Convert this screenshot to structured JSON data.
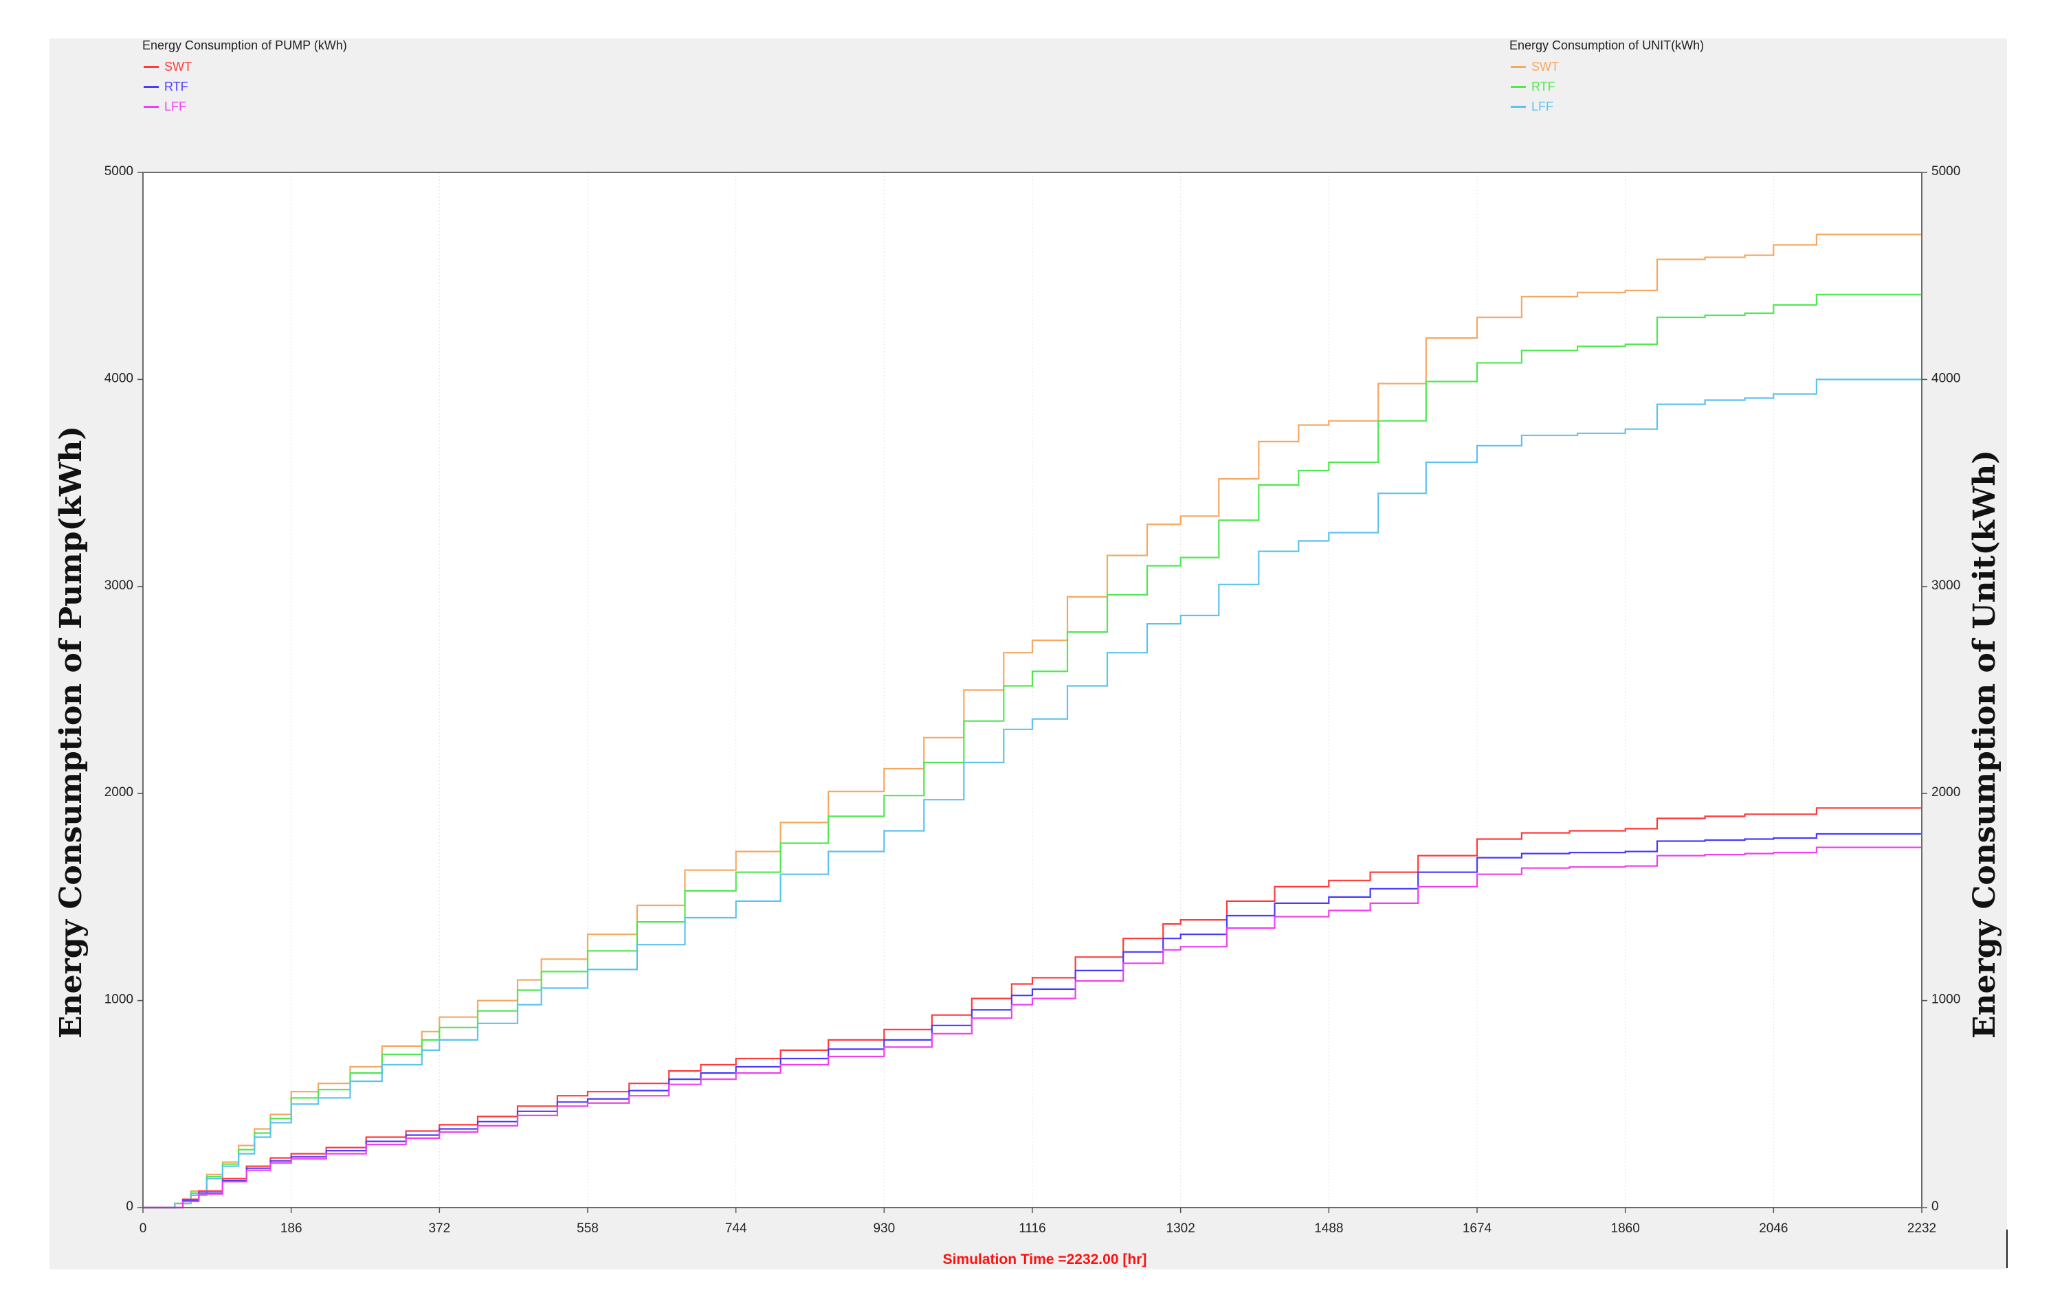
{
  "chart_data": {
    "type": "line",
    "x_axis": {
      "range": [
        0,
        2232
      ],
      "ticks": [
        0,
        186,
        372,
        558,
        744,
        930,
        1116,
        1302,
        1488,
        1674,
        1860,
        2046,
        2232
      ],
      "footer": "Simulation Time =2232.00 [hr]"
    },
    "y_left": {
      "label": "Energy Consumption of Pump(kWh)",
      "range": [
        0,
        5000
      ],
      "ticks": [
        0,
        1000,
        2000,
        3000,
        4000,
        5000
      ]
    },
    "y_right": {
      "label": "Energy Consumption of Unit(kWh)",
      "range": [
        0,
        5000
      ],
      "ticks": [
        0,
        1000,
        2000,
        3000,
        4000,
        5000
      ]
    },
    "legend_left": {
      "title": "Energy Consumption of PUMP (kWh)",
      "placement": "top-left",
      "entries": [
        "SWT",
        "RTF",
        "LFF"
      ]
    },
    "legend_right": {
      "title": "Energy Consumption of UNIT(kWh)",
      "placement": "top-right",
      "entries": [
        "SWT",
        "RTF",
        "LFF"
      ]
    },
    "grid": true,
    "series": [
      {
        "name": "SWT",
        "group": "UNIT",
        "color": "#f5a860",
        "points": [
          [
            0,
            0
          ],
          [
            20,
            0
          ],
          [
            40,
            20
          ],
          [
            60,
            80
          ],
          [
            80,
            160
          ],
          [
            100,
            220
          ],
          [
            120,
            300
          ],
          [
            140,
            380
          ],
          [
            160,
            450
          ],
          [
            186,
            560
          ],
          [
            220,
            600
          ],
          [
            260,
            680
          ],
          [
            300,
            780
          ],
          [
            350,
            850
          ],
          [
            372,
            920
          ],
          [
            420,
            1000
          ],
          [
            470,
            1100
          ],
          [
            500,
            1200
          ],
          [
            558,
            1320
          ],
          [
            620,
            1460
          ],
          [
            680,
            1630
          ],
          [
            744,
            1720
          ],
          [
            800,
            1860
          ],
          [
            860,
            2010
          ],
          [
            930,
            2120
          ],
          [
            980,
            2270
          ],
          [
            1030,
            2500
          ],
          [
            1080,
            2680
          ],
          [
            1116,
            2740
          ],
          [
            1160,
            2950
          ],
          [
            1210,
            3150
          ],
          [
            1260,
            3300
          ],
          [
            1302,
            3340
          ],
          [
            1350,
            3520
          ],
          [
            1400,
            3700
          ],
          [
            1450,
            3780
          ],
          [
            1488,
            3800
          ],
          [
            1550,
            3980
          ],
          [
            1610,
            4200
          ],
          [
            1674,
            4300
          ],
          [
            1730,
            4400
          ],
          [
            1800,
            4420
          ],
          [
            1860,
            4430
          ],
          [
            1900,
            4580
          ],
          [
            1960,
            4590
          ],
          [
            2010,
            4600
          ],
          [
            2046,
            4650
          ],
          [
            2100,
            4700
          ],
          [
            2232,
            4700
          ]
        ]
      },
      {
        "name": "RTF",
        "group": "UNIT",
        "color": "#50e850",
        "points": [
          [
            0,
            0
          ],
          [
            20,
            0
          ],
          [
            40,
            20
          ],
          [
            60,
            70
          ],
          [
            80,
            150
          ],
          [
            100,
            210
          ],
          [
            120,
            280
          ],
          [
            140,
            360
          ],
          [
            160,
            430
          ],
          [
            186,
            530
          ],
          [
            220,
            570
          ],
          [
            260,
            650
          ],
          [
            300,
            740
          ],
          [
            350,
            810
          ],
          [
            372,
            870
          ],
          [
            420,
            950
          ],
          [
            470,
            1050
          ],
          [
            500,
            1140
          ],
          [
            558,
            1240
          ],
          [
            620,
            1380
          ],
          [
            680,
            1530
          ],
          [
            744,
            1620
          ],
          [
            800,
            1760
          ],
          [
            860,
            1890
          ],
          [
            930,
            1990
          ],
          [
            980,
            2150
          ],
          [
            1030,
            2350
          ],
          [
            1080,
            2520
          ],
          [
            1116,
            2590
          ],
          [
            1160,
            2780
          ],
          [
            1210,
            2960
          ],
          [
            1260,
            3100
          ],
          [
            1302,
            3140
          ],
          [
            1350,
            3320
          ],
          [
            1400,
            3490
          ],
          [
            1450,
            3560
          ],
          [
            1488,
            3600
          ],
          [
            1550,
            3800
          ],
          [
            1610,
            3990
          ],
          [
            1674,
            4080
          ],
          [
            1730,
            4140
          ],
          [
            1800,
            4160
          ],
          [
            1860,
            4170
          ],
          [
            1900,
            4300
          ],
          [
            1960,
            4310
          ],
          [
            2010,
            4320
          ],
          [
            2046,
            4360
          ],
          [
            2100,
            4410
          ],
          [
            2232,
            4410
          ]
        ]
      },
      {
        "name": "LFF",
        "group": "UNIT",
        "color": "#5cc2ee",
        "points": [
          [
            0,
            0
          ],
          [
            20,
            0
          ],
          [
            40,
            20
          ],
          [
            60,
            60
          ],
          [
            80,
            140
          ],
          [
            100,
            200
          ],
          [
            120,
            260
          ],
          [
            140,
            340
          ],
          [
            160,
            410
          ],
          [
            186,
            500
          ],
          [
            220,
            530
          ],
          [
            260,
            610
          ],
          [
            300,
            690
          ],
          [
            350,
            760
          ],
          [
            372,
            810
          ],
          [
            420,
            890
          ],
          [
            470,
            980
          ],
          [
            500,
            1060
          ],
          [
            558,
            1150
          ],
          [
            620,
            1270
          ],
          [
            680,
            1400
          ],
          [
            744,
            1480
          ],
          [
            800,
            1610
          ],
          [
            860,
            1720
          ],
          [
            930,
            1820
          ],
          [
            980,
            1970
          ],
          [
            1030,
            2150
          ],
          [
            1080,
            2310
          ],
          [
            1116,
            2360
          ],
          [
            1160,
            2520
          ],
          [
            1210,
            2680
          ],
          [
            1260,
            2820
          ],
          [
            1302,
            2860
          ],
          [
            1350,
            3010
          ],
          [
            1400,
            3170
          ],
          [
            1450,
            3220
          ],
          [
            1488,
            3260
          ],
          [
            1550,
            3450
          ],
          [
            1610,
            3600
          ],
          [
            1674,
            3680
          ],
          [
            1730,
            3730
          ],
          [
            1800,
            3740
          ],
          [
            1860,
            3760
          ],
          [
            1900,
            3880
          ],
          [
            1960,
            3900
          ],
          [
            2010,
            3910
          ],
          [
            2046,
            3930
          ],
          [
            2100,
            4000
          ],
          [
            2232,
            4000
          ]
        ]
      },
      {
        "name": "SWT",
        "group": "PUMP",
        "color": "#ff3a3a",
        "points": [
          [
            0,
            0
          ],
          [
            30,
            0
          ],
          [
            50,
            40
          ],
          [
            70,
            80
          ],
          [
            100,
            140
          ],
          [
            130,
            200
          ],
          [
            160,
            240
          ],
          [
            186,
            260
          ],
          [
            230,
            290
          ],
          [
            280,
            340
          ],
          [
            330,
            370
          ],
          [
            372,
            400
          ],
          [
            420,
            440
          ],
          [
            470,
            490
          ],
          [
            520,
            540
          ],
          [
            558,
            560
          ],
          [
            610,
            600
          ],
          [
            660,
            660
          ],
          [
            700,
            690
          ],
          [
            744,
            720
          ],
          [
            800,
            760
          ],
          [
            860,
            810
          ],
          [
            930,
            860
          ],
          [
            990,
            930
          ],
          [
            1040,
            1010
          ],
          [
            1090,
            1080
          ],
          [
            1116,
            1110
          ],
          [
            1170,
            1210
          ],
          [
            1230,
            1300
          ],
          [
            1280,
            1370
          ],
          [
            1302,
            1390
          ],
          [
            1360,
            1480
          ],
          [
            1420,
            1550
          ],
          [
            1488,
            1580
          ],
          [
            1540,
            1620
          ],
          [
            1600,
            1700
          ],
          [
            1674,
            1780
          ],
          [
            1730,
            1810
          ],
          [
            1790,
            1820
          ],
          [
            1860,
            1830
          ],
          [
            1900,
            1880
          ],
          [
            1960,
            1890
          ],
          [
            2010,
            1900
          ],
          [
            2046,
            1900
          ],
          [
            2100,
            1930
          ],
          [
            2232,
            1930
          ]
        ]
      },
      {
        "name": "RTF",
        "group": "PUMP",
        "color": "#4a3aff",
        "points": [
          [
            0,
            0
          ],
          [
            30,
            0
          ],
          [
            50,
            35
          ],
          [
            70,
            70
          ],
          [
            100,
            130
          ],
          [
            130,
            190
          ],
          [
            160,
            225
          ],
          [
            186,
            245
          ],
          [
            230,
            275
          ],
          [
            280,
            320
          ],
          [
            330,
            350
          ],
          [
            372,
            380
          ],
          [
            420,
            415
          ],
          [
            470,
            465
          ],
          [
            520,
            510
          ],
          [
            558,
            525
          ],
          [
            610,
            565
          ],
          [
            660,
            620
          ],
          [
            700,
            650
          ],
          [
            744,
            680
          ],
          [
            800,
            720
          ],
          [
            860,
            765
          ],
          [
            930,
            810
          ],
          [
            990,
            880
          ],
          [
            1040,
            955
          ],
          [
            1090,
            1025
          ],
          [
            1116,
            1055
          ],
          [
            1170,
            1145
          ],
          [
            1230,
            1235
          ],
          [
            1280,
            1300
          ],
          [
            1302,
            1320
          ],
          [
            1360,
            1410
          ],
          [
            1420,
            1470
          ],
          [
            1488,
            1500
          ],
          [
            1540,
            1540
          ],
          [
            1600,
            1620
          ],
          [
            1674,
            1690
          ],
          [
            1730,
            1710
          ],
          [
            1790,
            1715
          ],
          [
            1860,
            1720
          ],
          [
            1900,
            1770
          ],
          [
            1960,
            1775
          ],
          [
            2010,
            1780
          ],
          [
            2046,
            1785
          ],
          [
            2100,
            1805
          ],
          [
            2232,
            1805
          ]
        ]
      },
      {
        "name": "LFF",
        "group": "PUMP",
        "color": "#ee40ee",
        "points": [
          [
            0,
            0
          ],
          [
            30,
            0
          ],
          [
            50,
            30
          ],
          [
            70,
            65
          ],
          [
            100,
            125
          ],
          [
            130,
            180
          ],
          [
            160,
            215
          ],
          [
            186,
            235
          ],
          [
            230,
            260
          ],
          [
            280,
            305
          ],
          [
            330,
            335
          ],
          [
            372,
            365
          ],
          [
            420,
            395
          ],
          [
            470,
            445
          ],
          [
            520,
            490
          ],
          [
            558,
            505
          ],
          [
            610,
            540
          ],
          [
            660,
            595
          ],
          [
            700,
            620
          ],
          [
            744,
            650
          ],
          [
            800,
            690
          ],
          [
            860,
            730
          ],
          [
            930,
            775
          ],
          [
            990,
            840
          ],
          [
            1040,
            915
          ],
          [
            1090,
            980
          ],
          [
            1116,
            1010
          ],
          [
            1170,
            1095
          ],
          [
            1230,
            1180
          ],
          [
            1280,
            1245
          ],
          [
            1302,
            1260
          ],
          [
            1360,
            1350
          ],
          [
            1420,
            1405
          ],
          [
            1488,
            1435
          ],
          [
            1540,
            1470
          ],
          [
            1600,
            1550
          ],
          [
            1674,
            1610
          ],
          [
            1730,
            1640
          ],
          [
            1790,
            1645
          ],
          [
            1860,
            1650
          ],
          [
            1900,
            1700
          ],
          [
            1960,
            1705
          ],
          [
            2010,
            1710
          ],
          [
            2046,
            1715
          ],
          [
            2100,
            1740
          ],
          [
            2232,
            1740
          ]
        ]
      }
    ]
  }
}
